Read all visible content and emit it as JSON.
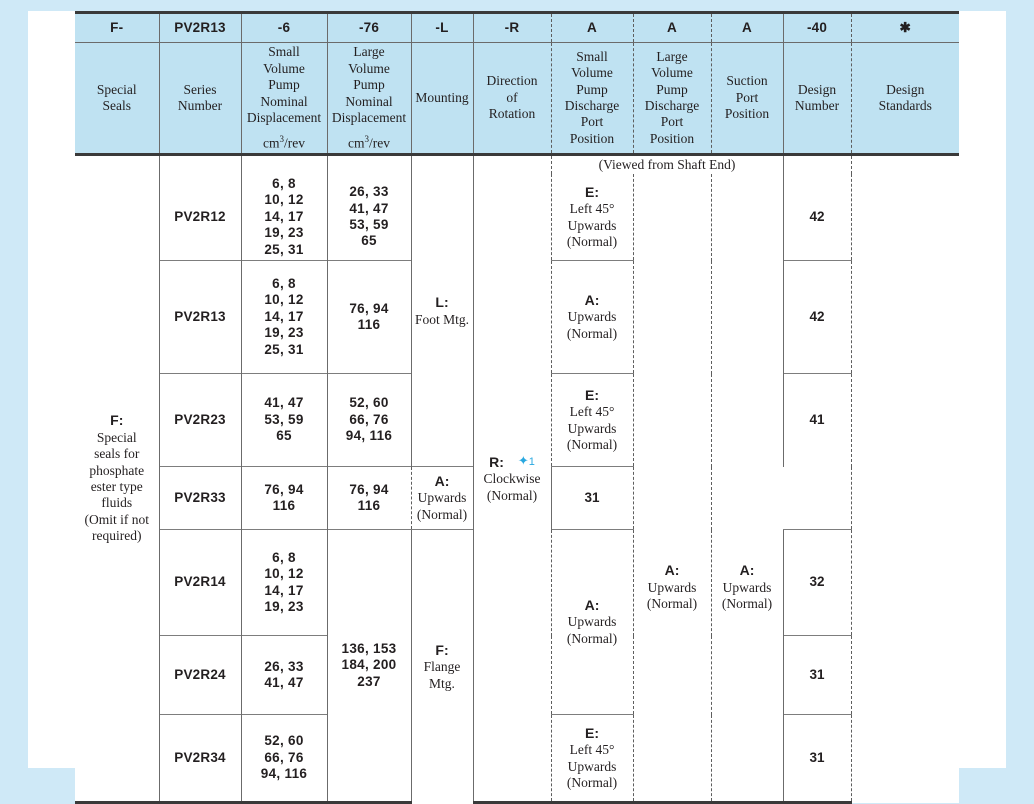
{
  "meta": {
    "page_background": "#cfe9f7",
    "header_background": "#bfe2f2",
    "accent_star_color": "#29a8e0",
    "text_color": "#231f20"
  },
  "header": {
    "codes": [
      "F-",
      "PV2R13",
      "-6",
      "-76",
      "-L",
      "-R",
      "A",
      "A",
      "A",
      "-40",
      "✱"
    ],
    "descriptions": [
      {
        "title": "Special\nSeals",
        "unit": ""
      },
      {
        "title": "Series\nNumber",
        "unit": ""
      },
      {
        "title": "Small\nVolume\nPump\nNominal\nDisplacement",
        "unit": "cm3/rev",
        "unit_base": "cm",
        "unit_sup": "3",
        "unit_tail": "/rev"
      },
      {
        "title": "Large\nVolume\nPump\nNominal\nDisplacement",
        "unit": "cm3/rev",
        "unit_base": "cm",
        "unit_sup": "3",
        "unit_tail": "/rev"
      },
      {
        "title": "Mounting",
        "unit": ""
      },
      {
        "title": "Direction\nof\nRotation",
        "unit": ""
      },
      {
        "title": "Small\nVolume\nPump\nDischarge\nPort\nPosition",
        "unit": ""
      },
      {
        "title": "Large\nVolume\nPump\nDischarge\nPort\nPosition",
        "unit": ""
      },
      {
        "title": "Suction\nPort\nPosition",
        "unit": ""
      },
      {
        "title": "Design\nNumber",
        "unit": ""
      },
      {
        "title": "Design\nStandards",
        "unit": ""
      }
    ]
  },
  "special_seals": {
    "code": "F:",
    "text": "Special\nseals for\nphosphate\nester type\nfluids\n(Omit if not\nrequired)"
  },
  "mounting": [
    {
      "code": "L:",
      "text": "Foot Mtg."
    },
    {
      "code": "F:",
      "text": "Flange\nMtg."
    }
  ],
  "direction_of_rotation": {
    "code": "R:",
    "text": "Clockwise\n(Normal)",
    "footnote_marker": "✦1"
  },
  "viewed_note": "(Viewed from Shaft End)",
  "series_rows": [
    {
      "series": "PV2R12",
      "small_disp": "6, 8\n10, 12\n14, 17\n19, 23\n25, 31",
      "large_disp": "26, 33\n41, 47\n53, 59\n65",
      "design_number": "42"
    },
    {
      "series": "PV2R13",
      "small_disp": "6, 8\n10, 12\n14, 17\n19, 23\n25, 31",
      "large_disp": "76, 94\n116",
      "design_number": "42"
    },
    {
      "series": "PV2R23",
      "small_disp": "41, 47\n53, 59\n65",
      "large_disp": "52, 60\n66, 76\n94, 116",
      "design_number": "41"
    },
    {
      "series": "PV2R33",
      "small_disp": "76, 94\n116",
      "large_disp": "76, 94\n116",
      "design_number": "31"
    },
    {
      "series": "PV2R14",
      "small_disp": "6, 8\n10, 12\n14, 17\n19, 23",
      "large_disp": "136, 153\n184, 200\n237",
      "design_number": "32"
    },
    {
      "series": "PV2R24",
      "small_disp": "26, 33\n41, 47",
      "large_disp": "",
      "design_number": "31"
    },
    {
      "series": "PV2R34",
      "small_disp": "52, 60\n66, 76\n94, 116",
      "large_disp": "",
      "design_number": "31"
    }
  ],
  "small_pump_discharge_port": [
    {
      "code": "E:",
      "text": "Left 45°\nUpwards\n(Normal)"
    },
    {
      "code": "A:",
      "text": "Upwards\n(Normal)"
    },
    {
      "code": "E:",
      "text": "Left 45°\nUpwards\n(Normal)"
    },
    {
      "code": "A:",
      "text": "Upwards\n(Normal)"
    },
    {
      "code": "A:",
      "text": "Upwards\n(Normal)"
    },
    {
      "code": "E:",
      "text": "Left 45°\nUpwards\n(Normal)"
    }
  ],
  "large_pump_discharge_port": {
    "code": "A:",
    "text": "Upwards\n(Normal)"
  },
  "suction_port_position": {
    "code": "A:",
    "text": "Upwards\n(Normal)"
  }
}
